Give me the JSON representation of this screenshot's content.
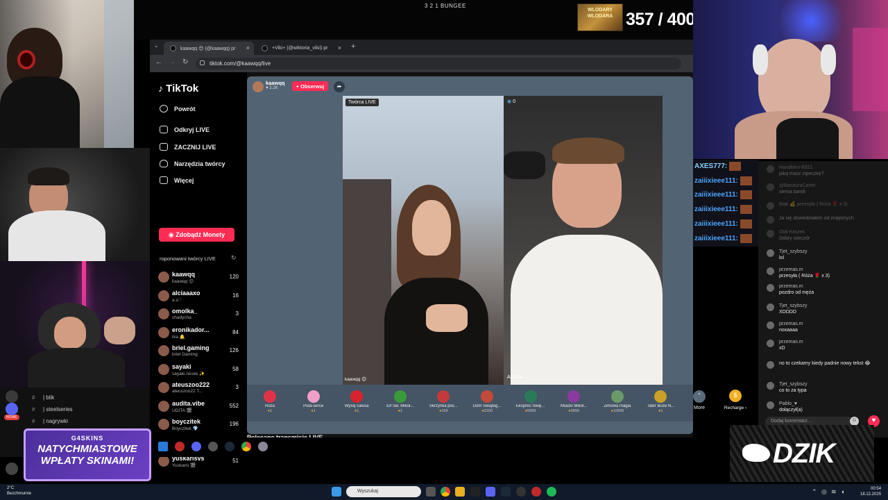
{
  "stream": {
    "title": "3 2 1 BUNGEE",
    "counter": "357 / 400",
    "counter_badge": "WLODARY WLODARA"
  },
  "browser": {
    "tabs": [
      {
        "label": "kaawqq 😊 (@kaawqq) pr"
      },
      {
        "label": "+Viki+ (@wiktoria_vikii) pr"
      }
    ],
    "url": "tiktok.com/@kaawqq/live",
    "new_tab": "+"
  },
  "tiktok": {
    "logo": "TikTok",
    "nav": [
      {
        "label": "Powrót",
        "icon": "back-arrow-icon"
      },
      {
        "label": "Odkryj LIVE",
        "icon": "live-tv-icon"
      },
      {
        "label": "ZACZNIJ LIVE",
        "icon": "camera-icon"
      },
      {
        "label": "Narzędzia twórcy",
        "icon": "lightbulb-icon"
      },
      {
        "label": "Więcej",
        "icon": "more-icon"
      }
    ],
    "monety_btn": "Zdobądź Monety",
    "proponowani": "roponowani twórcy LIVE",
    "creators": [
      {
        "name": "kaawqq",
        "sub": "kaawqq 😊",
        "count": "120"
      },
      {
        "name": "alciaaaxo",
        "sub": "a ≥♡",
        "count": "16"
      },
      {
        "name": "omolka_",
        "sub": "chadycha",
        "count": "3"
      },
      {
        "name": "eronikador...",
        "sub": "rka 🔔",
        "count": "84"
      },
      {
        "name": "briel.gaming",
        "sub": "briel Gaming",
        "count": "126"
      },
      {
        "name": "sayaki",
        "sub": "sayaki.nicole ✨",
        "count": "58"
      },
      {
        "name": "ateuszoo222",
        "sub": "ateuszoo22 T...",
        "count": "3"
      },
      {
        "name": "audita.vibe",
        "sub": "UDITA 🎬",
        "count": "552"
      },
      {
        "name": "boyczitek",
        "sub": "Boyczitek 💎",
        "count": "196"
      },
      {
        "name": "peligroso002",
        "sub": "✦ Peligroso",
        "count": "66"
      },
      {
        "name": "yuskarisvs",
        "sub": "Yuskaris 🎬",
        "count": "51"
      }
    ],
    "live": {
      "host_name": "kaawqq",
      "host_likes": "2.1K",
      "follow": "+ Obserwuj",
      "tworca_label": "Twórca LIVE",
      "video1_name": "kaawqq 😊",
      "video2_name": "AliScali",
      "video2_badge": "0"
    },
    "gifts": [
      {
        "name": "Róża",
        "price": "1",
        "color": "#e0334a"
      },
      {
        "name": "Puta-serce",
        "price": "1",
        "color": "#f0a0c8"
      },
      {
        "name": "Wyślij całusa",
        "price": "1",
        "color": "#d8232f"
      },
      {
        "name": "Elf Św. Mikoł...",
        "price": "1",
        "color": "#3a9a3a"
      },
      {
        "name": "Skrzynka poc...",
        "price": "109",
        "color": "#c23a3a"
      },
      {
        "name": "Dom Świąteg...",
        "price": "2200",
        "color": "#c24a3a"
      },
      {
        "name": "Ekspres Świę...",
        "price": "5999",
        "color": "#2a7a5a"
      },
      {
        "name": "Miasto Mikoł...",
        "price": "9999",
        "color": "#8a3aa0"
      },
      {
        "name": "Zimowa magia",
        "price": "10999",
        "color": "#6a9a6a"
      },
      {
        "name": "Tater Boże N...",
        "price": "1",
        "color": "#c8a02a"
      }
    ],
    "more": "More",
    "recharge": "Recharge ›",
    "polecane": "Polecane transmisje LIVE"
  },
  "chat": {
    "messages": [
      {
        "user": "HandMen-6921",
        "text": "jaką masz cipeczkę?"
      },
      {
        "user": "@BanduraCartel",
        "text": "siema bandi"
      },
      {
        "user": "Mati 💰 przesyła ( Róża 🌹 x 3)",
        "text": ""
      },
      {
        "user": "",
        "text": "Ja się dowiedziałem od znajomych"
      },
      {
        "user": "Olaf Kliszek",
        "text": "Dobry wieczór"
      },
      {
        "user": "Tjet_szybszy",
        "text": "lol"
      },
      {
        "user": "przemas.m",
        "text": "przesyła ( Róża 🌹 x 3)"
      },
      {
        "user": "przemas.m",
        "text": "pozdro od męża"
      },
      {
        "user": "Tjet_szybszy",
        "text": "XDDDD"
      },
      {
        "user": "przemas.m",
        "text": "noxaaaa"
      },
      {
        "user": "przemas.m",
        "text": "xD"
      },
      {
        "user": "",
        "text": "no to czekamy kiedy padnie nowy tekst 😂"
      },
      {
        "user": "Tjet_szybszy",
        "text": "co to za typa"
      },
      {
        "user": "Pablo_♥",
        "text": "dołączył(a)"
      }
    ],
    "badge_lvl": "20",
    "badge_rank": "Nr 1",
    "boss_badge": "BOSS",
    "input_placeholder": "Dodaj komentarz...",
    "heart": "♥"
  },
  "overlay_chat": [
    {
      "user": "AXES777:"
    },
    {
      "user": "zaiiixieee111:"
    },
    {
      "user": "zaiiixieee111:"
    },
    {
      "user": "zaiiixieee111:"
    },
    {
      "user": "zaiiixieee111:"
    },
    {
      "user": "zaiiixieee111:"
    }
  ],
  "discord": {
    "channels": [
      "| blik",
      "| steelseries",
      "| nagrywki"
    ],
    "badge_new": "NOWE"
  },
  "promo": {
    "brand": "G4SKINS",
    "line1": "NATYCHMIASTOWE",
    "line2": "WPŁATY SKINAMI!"
  },
  "dzik": {
    "text": "DZIK"
  },
  "taskbar": {
    "weather_temp": "2°C",
    "weather_desc": "Bezchmurnie",
    "search": "Wyszukaj",
    "time": "00:54",
    "date": "18.12.2025"
  }
}
